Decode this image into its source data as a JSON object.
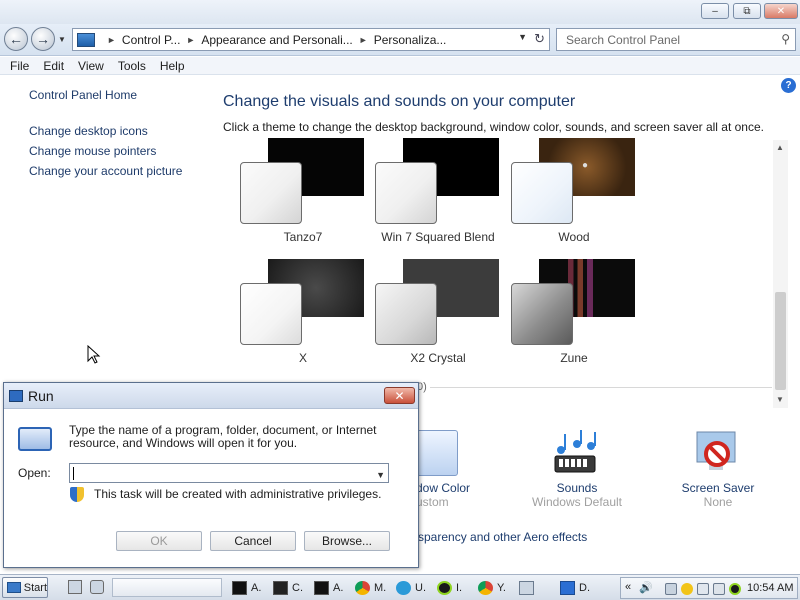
{
  "window": {
    "caption_buttons": [
      "–",
      "⧉",
      "✕"
    ]
  },
  "breadcrumb": {
    "items": [
      "Control P...",
      "Appearance and Personali...",
      "Personaliza..."
    ]
  },
  "search": {
    "placeholder": "Search Control Panel"
  },
  "menu": [
    "File",
    "Edit",
    "View",
    "Tools",
    "Help"
  ],
  "sidebar": {
    "home": "Control Panel Home",
    "links": [
      "Change desktop icons",
      "Change mouse pointers",
      "Change your account picture"
    ]
  },
  "main": {
    "title": "Change the visuals and sounds on your computer",
    "subtitle": "Click a theme to change the desktop background, window color, sounds, and screen saver all at once.",
    "themes": [
      {
        "name": "Tanzo7",
        "bg_color": "#050505"
      },
      {
        "name": "Win 7 Squared Blend",
        "bg_color": "#000000"
      },
      {
        "name": "Wood",
        "bg_color": "#3a2410"
      },
      {
        "name": "X",
        "bg_color": "#2a2a2a"
      },
      {
        "name": "X2 Crystal",
        "bg_color": "#3c3c3c"
      },
      {
        "name": "Zune",
        "bg_color": "#0b0b0b"
      }
    ],
    "section_count_fragment": "0)",
    "bottom": {
      "window_color_title": "dow Color",
      "window_color_sub": "ustom",
      "sounds_title": "Sounds",
      "sounds_sub": "Windows Default",
      "screensaver_title": "Screen Saver",
      "screensaver_sub": "None",
      "aero_text": "sparency and other Aero effects"
    }
  },
  "run_dialog": {
    "title": "Run",
    "description": "Type the name of a program, folder, document, or Internet resource, and Windows will open it for you.",
    "open_label": "Open:",
    "open_value": "",
    "admin_note": "This task will be created with administrative privileges.",
    "ok": "OK",
    "cancel": "Cancel",
    "browse": "Browse..."
  },
  "taskbar": {
    "start": "Start",
    "tasks": [
      "A.",
      "C.",
      "A.",
      "M.",
      "U.",
      "I.",
      "Y.",
      "",
      "D."
    ],
    "clock": "10:54 AM"
  }
}
